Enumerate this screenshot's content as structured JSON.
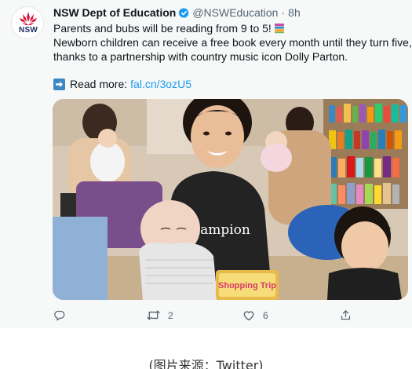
{
  "account": {
    "display_name": "NSW Dept of Education",
    "handle": "@NSWEducation",
    "separator": "·",
    "time": "8h",
    "avatar_text": "NSW"
  },
  "tweet": {
    "line1": "Parents and bubs will be reading from 9 to 5!",
    "line2": "Newborn children can receive a free book every month until they turn five,",
    "line3": "thanks to a partnership with country music icon Dolly Parton.",
    "read_more_label": "Read more:",
    "link_text": "fal.cn/3ozU5"
  },
  "photo": {
    "book_title": "Shopping Trip",
    "shirt_text": "Champion"
  },
  "actions": {
    "reply_count": "",
    "retweet_count": "2",
    "like_count": "6"
  },
  "caption": "(图片来源：Twitter)",
  "colors": {
    "link": "#1d9bf0",
    "muted": "#536471",
    "verified": "#1d9bf0",
    "card_bg": "#f7f9f9",
    "brand_red": "#d7153a"
  },
  "icons": {
    "verified": "verified-badge-icon",
    "books": "books-emoji-icon",
    "read_more": "right-arrow-box-icon",
    "reply": "reply-icon",
    "retweet": "retweet-icon",
    "like": "heart-icon",
    "share": "share-icon"
  }
}
